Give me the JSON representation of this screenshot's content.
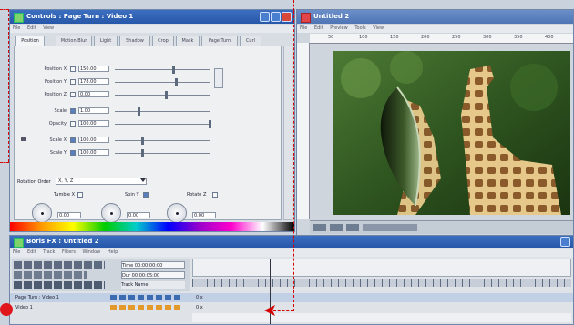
{
  "effect_window": {
    "title": "Controls : Page Turn : Video 1",
    "menu": [
      "File",
      "Edit",
      "View"
    ],
    "tabs": [
      "Position",
      "Motion Blur",
      "Light",
      "Shadow",
      "Crop",
      "Mask",
      "Page Turn",
      "Curl"
    ],
    "params": [
      {
        "label": "Position X",
        "value": "150.00"
      },
      {
        "label": "Position Y",
        "value": "178.00"
      },
      {
        "label": "Position Z",
        "value": "0.00"
      },
      {
        "label": "Scale",
        "value": "1.00"
      },
      {
        "label": "Opacity",
        "value": "100.00"
      },
      {
        "label": "Scale X",
        "value": "100.00"
      },
      {
        "label": "Scale Y",
        "value": "100.00"
      }
    ],
    "rotation_order_label": "Rotation Order",
    "rotation_order_value": "X, Y, Z",
    "knobs": [
      {
        "label": "Tumble X",
        "value": "0.00"
      },
      {
        "label": "Spin Y",
        "value": "0.00"
      },
      {
        "label": "Rotate Z",
        "value": "0.00"
      }
    ]
  },
  "preview_window": {
    "title": "Untitled 2",
    "menu": [
      "File",
      "Edit",
      "Preview",
      "Tools",
      "View"
    ],
    "ruler_ticks": [
      "50",
      "100",
      "150",
      "200",
      "250",
      "300",
      "350",
      "400"
    ]
  },
  "timeline_window": {
    "title": "Boris FX : Untitled 2",
    "menu": [
      "File",
      "Edit",
      "Track",
      "Filters",
      "Window",
      "Help"
    ],
    "time1": "Time 00:00:00:00",
    "time2": "Dur 00:00:05:00",
    "time3": "Track Name",
    "tracks": [
      {
        "name": "Page Turn : Video 1",
        "keys": "0 x"
      },
      {
        "name": "Video 1",
        "keys": "0 x"
      }
    ]
  },
  "colors": {
    "accent": "#2657a8",
    "annotation": "#d40000"
  }
}
